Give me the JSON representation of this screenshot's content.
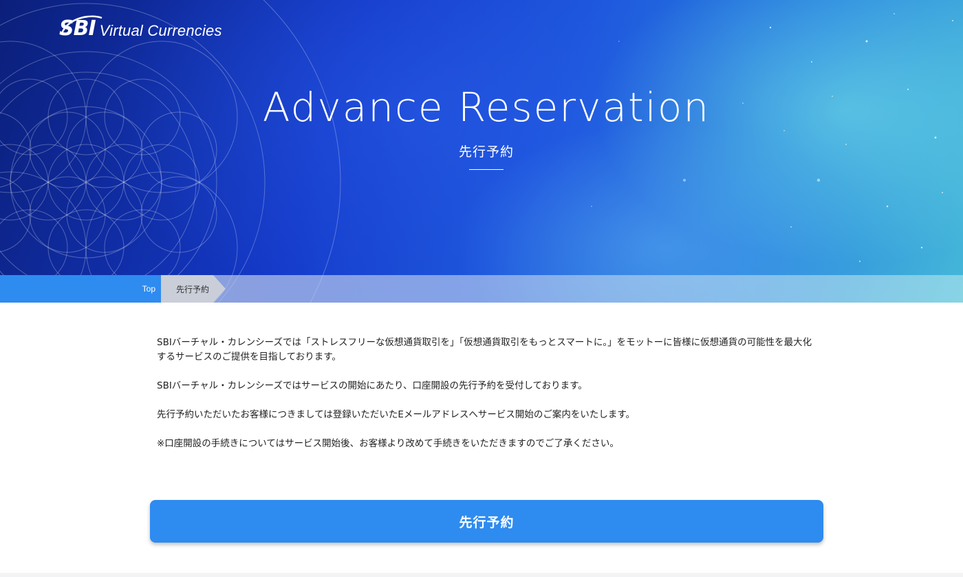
{
  "brand": {
    "logo_mark": "SBI",
    "logo_text": "Virtual Currencies"
  },
  "hero": {
    "title": "Advance Reservation",
    "subtitle": "先行予約"
  },
  "breadcrumb": {
    "home": "Top",
    "current": "先行予約"
  },
  "content": {
    "paragraphs": [
      "SBIバーチャル・カレンシーズでは「ストレスフリーな仮想通貨取引を」「仮想通貨取引をもっとスマートに。」をモットーに皆様に仮想通貨の可能性を最大化するサービスのご提供を目指しております。",
      "SBIバーチャル・カレンシーズではサービスの開始にあたり、口座開設の先行予約を受付しております。",
      "先行予約いただいたお客様につきましては登録いただいたEメールアドレスへサービス開始のご案内をいたします。",
      "※口座開設の手続きについてはサービス開始後、お客様より改めて手続きをいただきますのでご了承ください。"
    ]
  },
  "cta": {
    "label": "先行予約"
  },
  "colors": {
    "accent": "#2e8bf0",
    "breadcrumb_current_bg": "#c9ced8"
  }
}
